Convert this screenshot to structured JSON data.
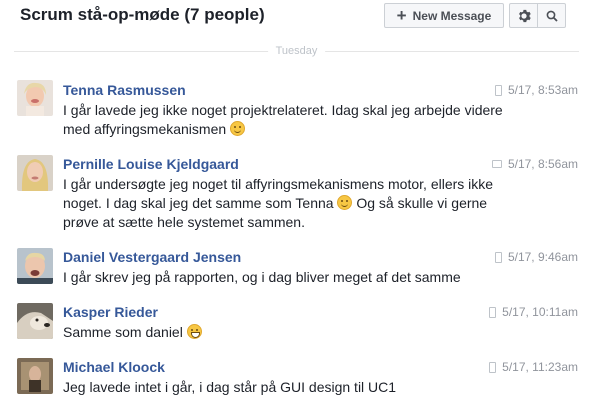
{
  "conversation": {
    "title": "Scrum stå-op-møde (7 people)"
  },
  "toolbar": {
    "new_message_label": "New Message"
  },
  "divider": {
    "label": "Tuesday"
  },
  "messages": [
    {
      "name": "Tenna Rasmussen",
      "text_1": "I går lavede jeg ikke noget projektrelateret. Idag skal jeg arbejde videre med affyringsmekanismen",
      "text_2": "",
      "time": "5/17, 8:53am",
      "device": "mobile-icon"
    },
    {
      "name": "Pernille Louise Kjeldgaard",
      "text_1": "I går undersøgte jeg noget til affyringsmekanismens motor, ellers ikke noget. I dag skal jeg det samme som Tenna",
      "text_2": "Og så skulle vi gerne prøve at sætte hele systemet sammen.",
      "time": "5/17, 8:56am",
      "device": "chat-icon"
    },
    {
      "name": "Daniel Vestergaard Jensen",
      "text_1": "I går skrev jeg på rapporten,  og i dag bliver meget af det samme",
      "text_2": "",
      "time": "5/17, 9:46am",
      "device": "mobile-icon"
    },
    {
      "name": "Kasper Rieder",
      "text_1": "Samme som daniel",
      "text_2": "",
      "time": "5/17, 10:11am",
      "device": "mobile-icon"
    },
    {
      "name": "Michael Kloock",
      "text_1": "Jeg lavede intet i går, i dag står på GUI design til UC1",
      "text_2": "",
      "time": "5/17, 11:23am",
      "device": "mobile-icon"
    }
  ]
}
